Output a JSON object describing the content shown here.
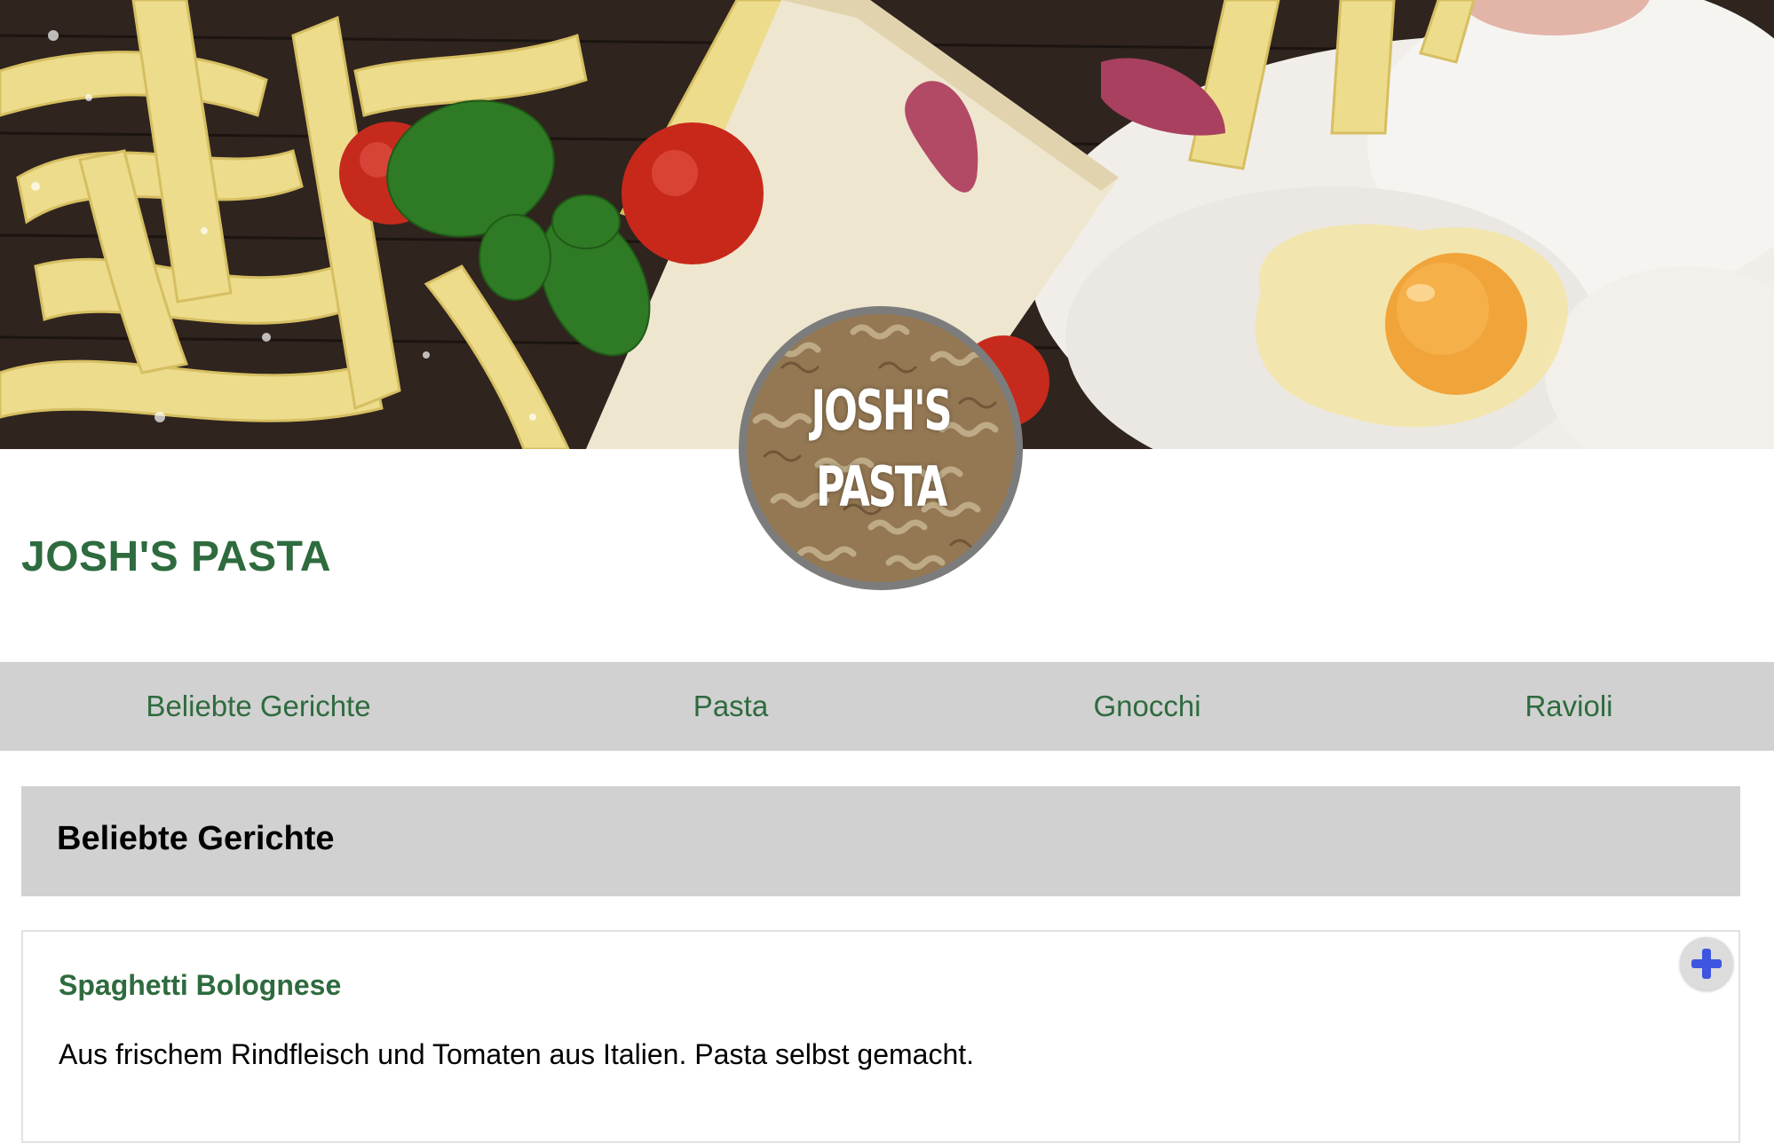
{
  "header": {
    "banner_image": "pasta-ingredients-banner",
    "logo_image": "fusilli-logo",
    "logo_line1": "JOSH'S",
    "logo_line2": "PASTA",
    "site_title": "JOSH'S PASTA"
  },
  "nav": {
    "items": [
      {
        "label": "Beliebte Gerichte"
      },
      {
        "label": "Pasta"
      },
      {
        "label": "Gnocchi"
      },
      {
        "label": "Ravioli"
      }
    ]
  },
  "section": {
    "title": "Beliebte Gerichte",
    "dishes": [
      {
        "name": "Spaghetti Bolognese",
        "description": "Aus frischem Rindfleisch und Tomaten aus Italien. Pasta selbst gemacht.",
        "add_icon": "plus-icon"
      }
    ]
  },
  "colors": {
    "brand_green": "#2e6b3e",
    "nav_background": "#d1d1d1",
    "add_button_blue": "#3d55e0"
  }
}
